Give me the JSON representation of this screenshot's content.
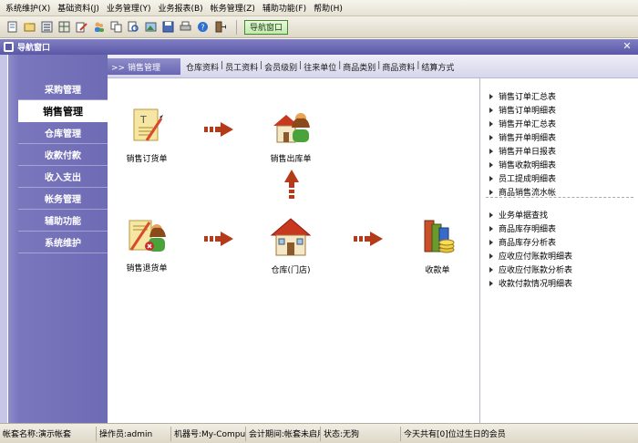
{
  "menu": [
    {
      "label": "系统维护",
      "key": "(X)"
    },
    {
      "label": "基础资料",
      "key": "(J)"
    },
    {
      "label": "业务管理",
      "key": "(Y)"
    },
    {
      "label": "业务报表",
      "key": "(B)"
    },
    {
      "label": "帐务管理",
      "key": "(Z)"
    },
    {
      "label": "辅助功能",
      "key": "(F)"
    },
    {
      "label": "帮助",
      "key": "(H)"
    }
  ],
  "toolbar": {
    "icons": [
      "new-doc-icon",
      "open-icon",
      "list-icon",
      "grid-icon",
      "edit-icon",
      "users-icon",
      "copy-icon",
      "print-preview-icon",
      "image-icon",
      "save-icon",
      "print-icon",
      "help-icon",
      "exit-icon"
    ],
    "nav_button_label": "导航窗口"
  },
  "window": {
    "title": "导航窗口"
  },
  "sidebar": {
    "items": [
      {
        "label": "采购管理",
        "active": false
      },
      {
        "label": "销售管理",
        "active": true
      },
      {
        "label": "仓库管理",
        "active": false
      },
      {
        "label": "收款付款",
        "active": false
      },
      {
        "label": "收入支出",
        "active": false
      },
      {
        "label": "帐务管理",
        "active": false
      },
      {
        "label": "辅助功能",
        "active": false
      },
      {
        "label": "系统维护",
        "active": false
      }
    ]
  },
  "content_header": {
    "module_label": ">> 销售管理",
    "links": [
      "仓库资料",
      "员工资料",
      "会员级别",
      "往来单位",
      "商品类别",
      "商品资料",
      "结算方式"
    ]
  },
  "flow": {
    "sales_order": "销售订货单",
    "sales_outbound": "销售出库单",
    "sales_return": "销售退货单",
    "warehouse_store": "仓库(门店)",
    "receipt": "收款单"
  },
  "reports": {
    "group1": [
      "销售订单汇总表",
      "销售订单明细表",
      "销售开单汇总表",
      "销售开单明细表",
      "销售开单日报表",
      "销售收款明细表",
      "员工提成明细表",
      "商品销售流水帐"
    ],
    "group2": [
      "业务单据查找",
      "商品库存明细表",
      "商品库存分析表",
      "应收应付账款明细表",
      "应收应付账款分析表",
      "收款付款情况明细表"
    ]
  },
  "status": {
    "account": "帐套名称:演示帐套",
    "operator": "操作员:admin",
    "machine": "机器号:My-Computer",
    "period": "会计期间:帐套未启用",
    "state": "状态:无狗",
    "birthday": "今天共有[0]位过生日的会员"
  }
}
